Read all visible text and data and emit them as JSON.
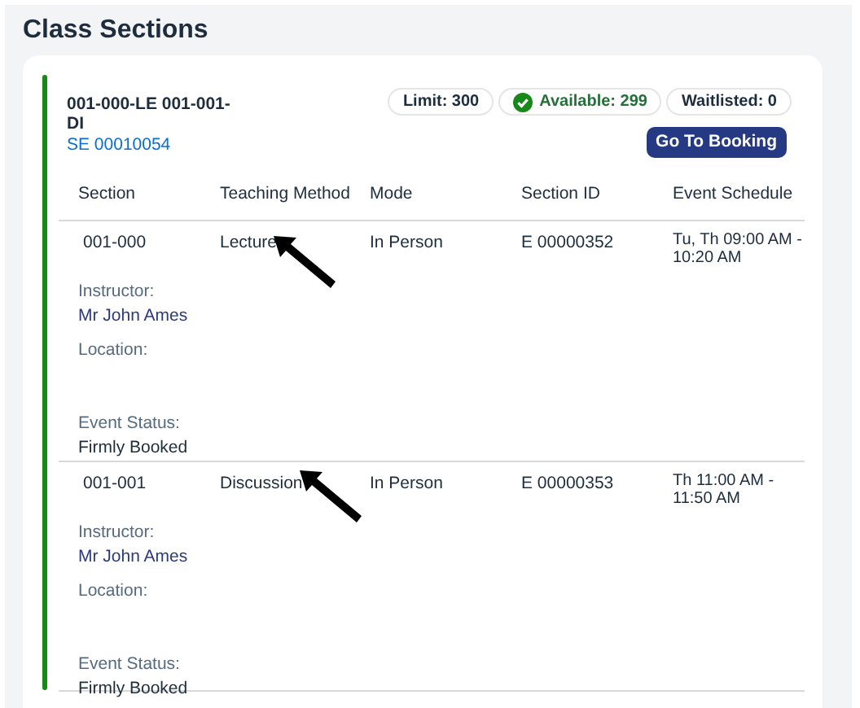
{
  "title": "Class Sections",
  "card": {
    "name": "001-000-LE 001-001-DI",
    "code": "SE 00010054",
    "badges": [
      {
        "kind": "plain",
        "label": "Limit: 300"
      },
      {
        "kind": "success",
        "label": "Available: 299"
      },
      {
        "kind": "plain",
        "label": "Waitlisted: 0"
      }
    ],
    "button": "Go To Booking",
    "columns": [
      "Section",
      "Teaching Method",
      "Mode",
      "Section ID",
      "Event Schedule"
    ],
    "rows": [
      {
        "section": "001-000",
        "teaching_method": "Lecture",
        "mode": "In Person",
        "section_id": "E 00000352",
        "event_schedule": "Tu, Th 09:00 AM - 10:20 AM",
        "instructor_label": "Instructor:",
        "instructor": "Mr John Ames",
        "location_label": "Location:",
        "event_status_label": "Event Status:",
        "event_status": "Firmly Booked",
        "arrow": true
      },
      {
        "section": "001-001",
        "teaching_method": "Discussion",
        "mode": "In Person",
        "section_id": "E 00000353",
        "event_schedule": "Th 11:00 AM - 11:50 AM",
        "instructor_label": "Instructor:",
        "instructor": "Mr John Ames",
        "location_label": "Location:",
        "event_status_label": "Event Status:",
        "event_status": "Firmly Booked",
        "arrow": true
      }
    ]
  }
}
